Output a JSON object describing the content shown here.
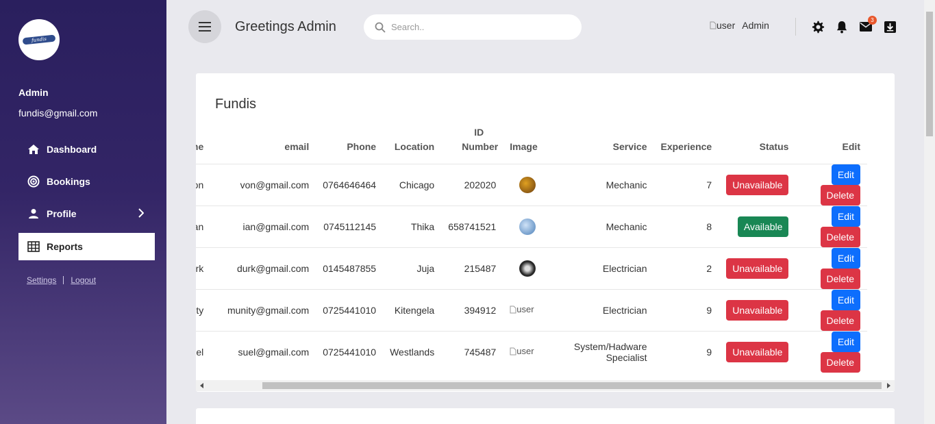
{
  "sidebar": {
    "logo_text": "fundis",
    "user_name": "Admin",
    "user_email": "fundis@gmail.com",
    "items": [
      {
        "label": "Dashboard",
        "icon": "home-icon"
      },
      {
        "label": "Bookings",
        "icon": "target-icon"
      },
      {
        "label": "Profile",
        "icon": "user-icon"
      },
      {
        "label": "Reports",
        "icon": "table-grid-icon"
      }
    ],
    "settings_label": "Settings",
    "logout_label": "Logout"
  },
  "header": {
    "greeting": "Greetings Admin",
    "search_placeholder": "Search..",
    "user_alt": "user",
    "user_name": "Admin",
    "mail_badge": "3"
  },
  "table": {
    "title": "Fundis",
    "columns": [
      "Name",
      "email",
      "Phone",
      "Location",
      "ID Number",
      "Image",
      "Service",
      "Experience",
      "Status",
      "Edit"
    ],
    "rows": [
      {
        "name": "von",
        "email": "von@gmail.com",
        "phone": "0764646464",
        "location": "Chicago",
        "id_number": "202020",
        "image": "avatar",
        "service": "Mechanic",
        "experience": "7",
        "status": "Unavailable"
      },
      {
        "name": "ian",
        "email": "ian@gmail.com",
        "phone": "0745112145",
        "location": "Thika",
        "id_number": "658741521",
        "image": "avatar",
        "service": "Mechanic",
        "experience": "8",
        "status": "Available"
      },
      {
        "name": "durk",
        "email": "durk@gmail.com",
        "phone": "0145487855",
        "location": "Juja",
        "id_number": "215487",
        "image": "avatar",
        "service": "Electrician",
        "experience": "2",
        "status": "Unavailable"
      },
      {
        "name": "munity",
        "email": "munity@gmail.com",
        "phone": "0725441010",
        "location": "Kitengela",
        "id_number": "394912",
        "image": "user",
        "service": "Electrician",
        "experience": "9",
        "status": "Unavailable"
      },
      {
        "name": "suel",
        "email": "suel@gmail.com",
        "phone": "0725441010",
        "location": "Westlands",
        "id_number": "745487",
        "image": "user",
        "service": "System/Hadware Specialist",
        "experience": "9",
        "status": "Unavailable"
      }
    ],
    "edit_label": "Edit",
    "delete_label": "Delete"
  },
  "colors": {
    "unavailable": "#dc3545",
    "available": "#198754",
    "edit": "#0d6efd",
    "delete": "#dc3545",
    "sidebar_top": "#2a1f5e",
    "sidebar_bottom": "#5b4a86"
  }
}
